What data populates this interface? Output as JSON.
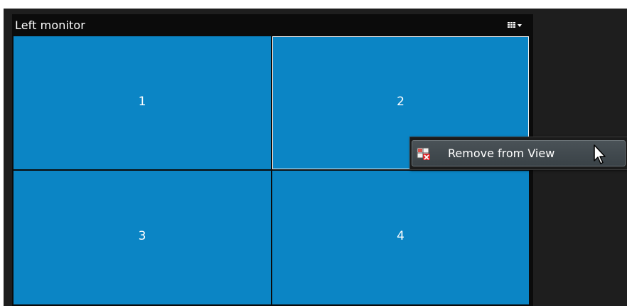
{
  "panel": {
    "title": "Left monitor"
  },
  "layout_button": {
    "icon": "grid-layout-icon",
    "dropdown_icon": "chevron-down-icon"
  },
  "view": {
    "cells": [
      {
        "label": "1"
      },
      {
        "label": "2"
      },
      {
        "label": "3"
      },
      {
        "label": "4"
      }
    ]
  },
  "context_menu": {
    "items": [
      {
        "label": "Remove from View",
        "icon": "remove-from-view-icon"
      }
    ]
  },
  "colors": {
    "cell_blue": "#0b85c5",
    "background": "#1e1e1e",
    "header": "#0b0b0b"
  }
}
